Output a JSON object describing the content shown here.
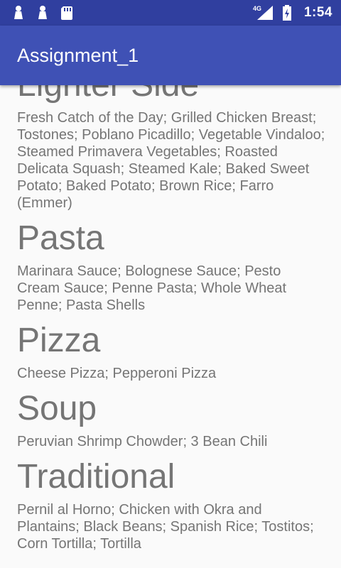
{
  "status_bar": {
    "time": "1:54",
    "network": "4G",
    "icons": [
      "notification-pawn-icon",
      "notification-pawn-icon",
      "sd-card-icon",
      "signal-icon",
      "battery-icon"
    ]
  },
  "app_bar": {
    "title": "Assignment_1"
  },
  "colors": {
    "status_bar": "#303f9f",
    "app_bar": "#3f51b5",
    "background": "#fafafa",
    "text": "#757575"
  },
  "sections": [
    {
      "title": "Lighter Side",
      "items": "Fresh Catch of the Day; Grilled Chicken Breast; Tostones; Poblano Picadillo; Vegetable Vindaloo; Steamed Primavera Vegetables; Roasted Delicata Squash; Steamed Kale; Baked Sweet Potato; Baked Potato; Brown Rice; Farro (Emmer)"
    },
    {
      "title": "Pasta",
      "items": "Marinara Sauce; Bolognese Sauce; Pesto Cream Sauce; Penne Pasta; Whole Wheat Penne; Pasta Shells"
    },
    {
      "title": "Pizza",
      "items": "Cheese Pizza; Pepperoni Pizza"
    },
    {
      "title": "Soup",
      "items": "Peruvian Shrimp Chowder; 3 Bean Chili"
    },
    {
      "title": "Traditional",
      "items": "Pernil al Horno; Chicken with Okra and Plantains; Black Beans; Spanish Rice; Tostitos; Corn Tortilla; Tortilla"
    }
  ]
}
